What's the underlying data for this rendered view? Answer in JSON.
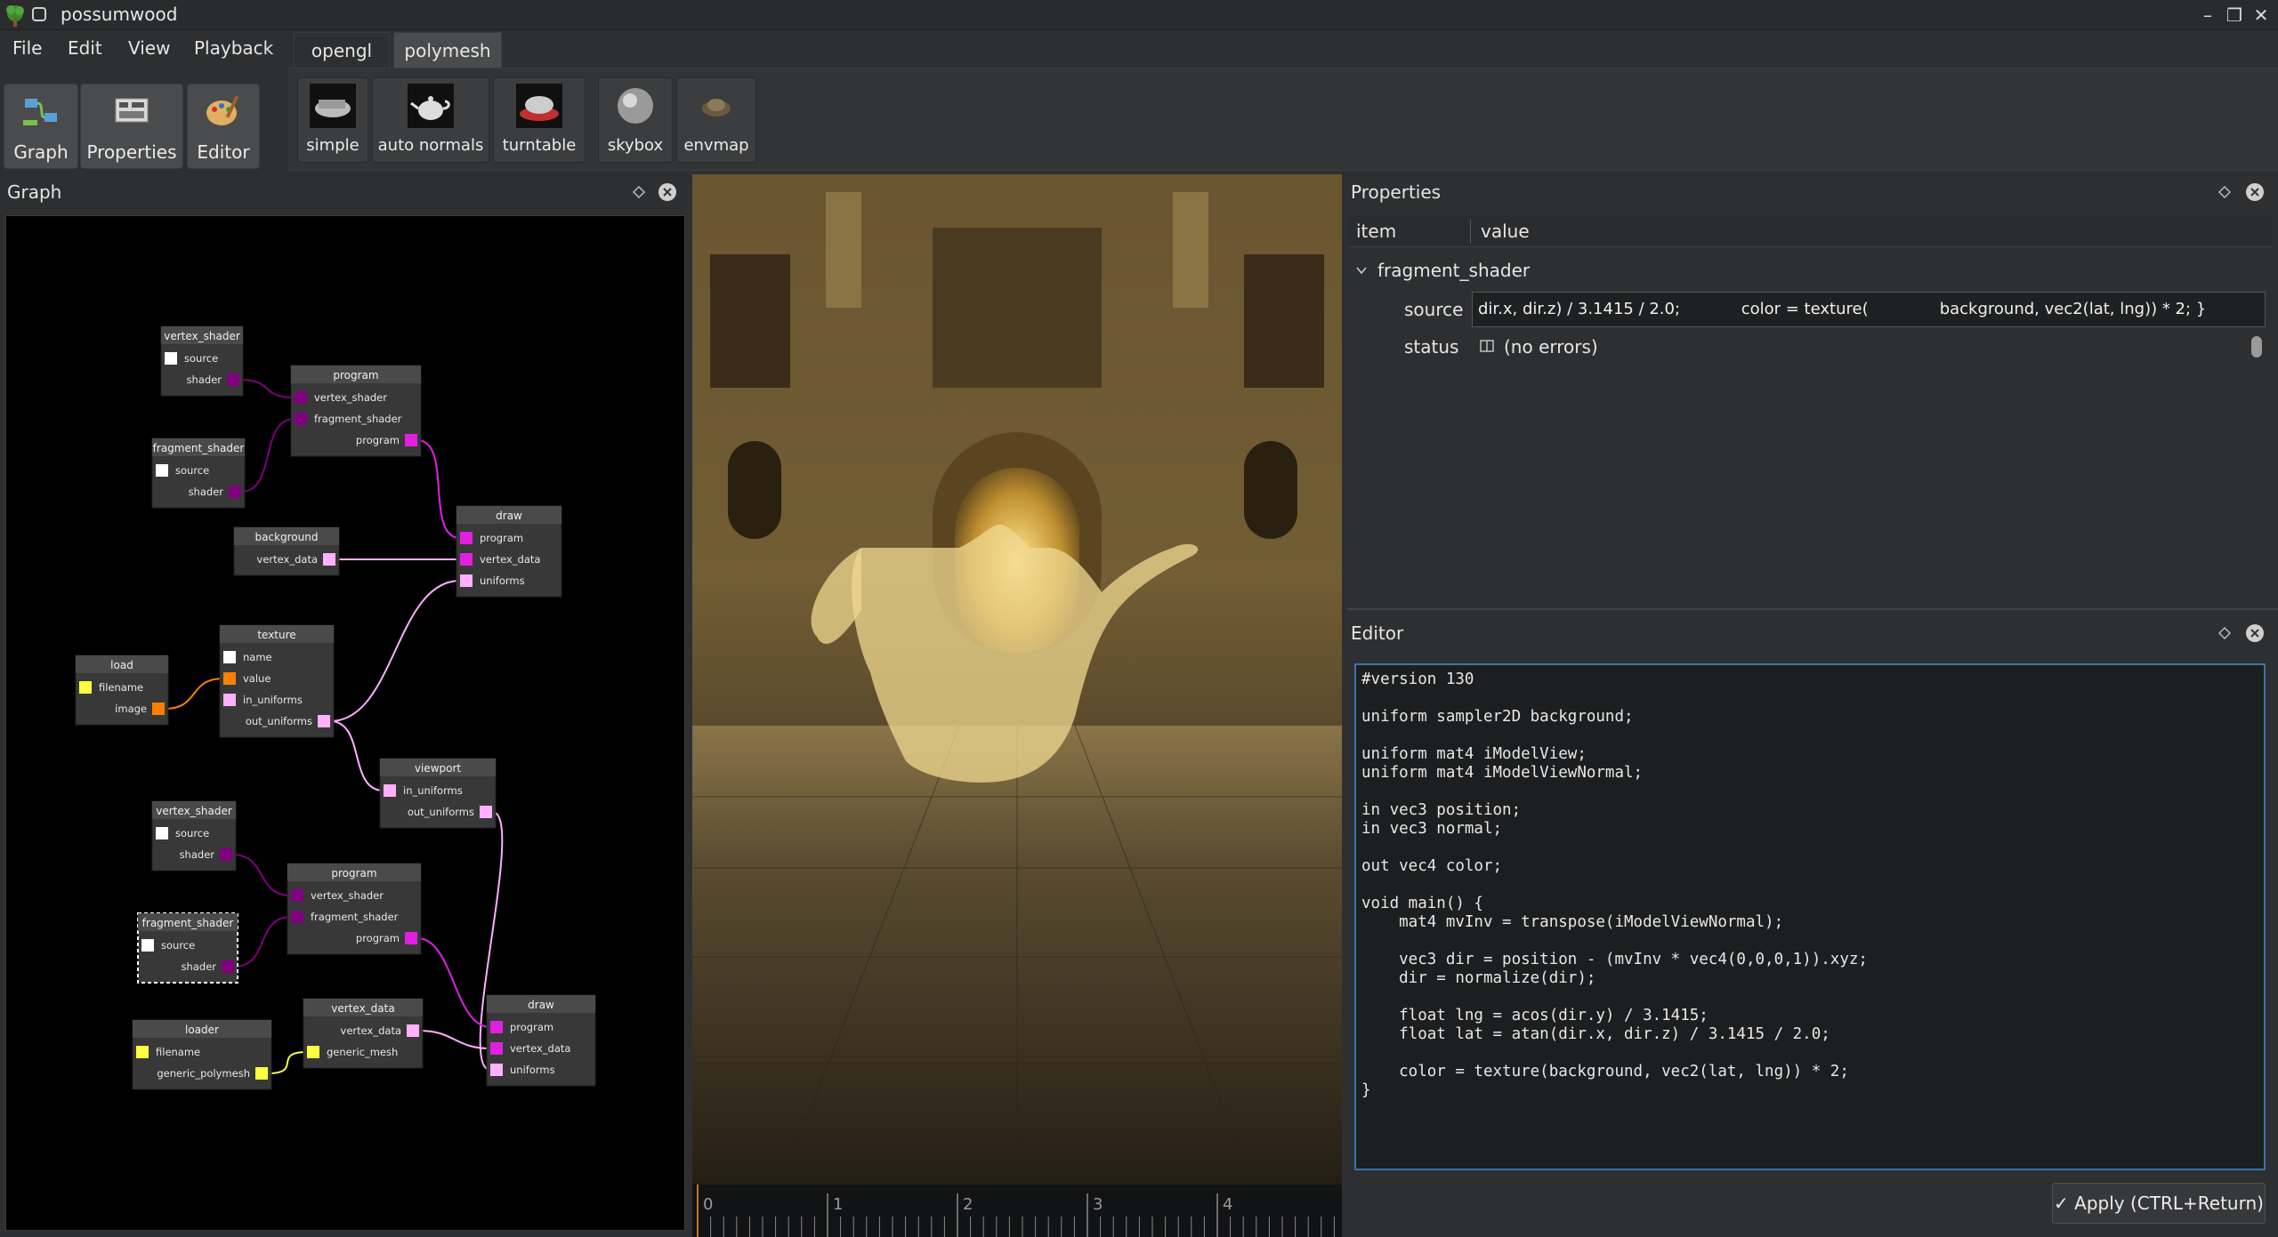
{
  "window": {
    "title": "possumwood",
    "minimize": "–",
    "maximize": "❐",
    "close": "✕"
  },
  "menu": {
    "items": [
      "File",
      "Edit",
      "View",
      "Playback"
    ]
  },
  "toolbar": {
    "buttons": [
      "Graph",
      "Properties",
      "Editor"
    ]
  },
  "tabs": {
    "items": [
      "opengl",
      "polymesh"
    ],
    "active": "polymesh"
  },
  "shelf": {
    "buttons": [
      "simple",
      "auto normals",
      "turntable",
      "skybox",
      "envmap"
    ]
  },
  "graph_panel": {
    "title": "Graph",
    "nodes": [
      {
        "title": "vertex_shader",
        "ports": [
          "source",
          "shader"
        ]
      },
      {
        "title": "program",
        "ports": [
          "vertex_shader",
          "fragment_shader",
          "program"
        ]
      },
      {
        "title": "fragment_shader",
        "ports": [
          "source",
          "shader"
        ]
      },
      {
        "title": "background",
        "ports": [
          "vertex_data"
        ]
      },
      {
        "title": "draw",
        "ports": [
          "program",
          "vertex_data",
          "uniforms"
        ]
      },
      {
        "title": "load",
        "ports": [
          "filename",
          "image"
        ]
      },
      {
        "title": "texture",
        "ports": [
          "name",
          "value",
          "in_uniforms",
          "out_uniforms"
        ]
      },
      {
        "title": "viewport",
        "ports": [
          "in_uniforms",
          "out_uniforms"
        ]
      },
      {
        "title": "vertex_shader",
        "ports": [
          "source",
          "shader"
        ]
      },
      {
        "title": "program",
        "ports": [
          "vertex_shader",
          "fragment_shader",
          "program"
        ]
      },
      {
        "title": "fragment_shader",
        "ports": [
          "source",
          "shader"
        ]
      },
      {
        "title": "loader",
        "ports": [
          "filename",
          "generic_polymesh"
        ]
      },
      {
        "title": "vertex_data",
        "ports": [
          "vertex_data",
          "generic_mesh"
        ]
      },
      {
        "title": "draw",
        "ports": [
          "program",
          "vertex_data",
          "uniforms"
        ]
      }
    ]
  },
  "timeline": {
    "ticks": [
      "0",
      "1",
      "2",
      "3",
      "4"
    ]
  },
  "properties_panel": {
    "title": "Properties",
    "col_item": "item",
    "col_value": "value",
    "group": "fragment_shader",
    "rows": [
      {
        "name": "source",
        "value": "dir.x, dir.z) / 3.1415 / 2.0;            color = texture(              background, vec2(lat, lng)) * 2; }"
      },
      {
        "name": "status",
        "value": "(no errors)"
      }
    ]
  },
  "editor_panel": {
    "title": "Editor",
    "code": "#version 130\n\nuniform sampler2D background;\n\nuniform mat4 iModelView;\nuniform mat4 iModelViewNormal;\n\nin vec3 position;\nin vec3 normal;\n\nout vec4 color;\n\nvoid main() {\n    mat4 mvInv = transpose(iModelViewNormal);\n\n    vec3 dir = position - (mvInv * vec4(0,0,0,1)).xyz;\n    dir = normalize(dir);\n\n    float lng = acos(dir.y) / 3.1415;\n    float lat = atan(dir.x, dir.z) / 3.1415 / 2.0;\n\n    color = texture(background, vec2(lat, lng)) * 2;\n}",
    "apply_label": "Apply (CTRL+Return)"
  },
  "colors": {
    "bg": "#2e2f30",
    "port_magenta": "#e020e0",
    "port_pink": "#ffb0ff",
    "port_orange": "#ff8000",
    "port_yellow": "#ffff40",
    "port_purple": "#800080",
    "accent": "#3d6fb0"
  }
}
